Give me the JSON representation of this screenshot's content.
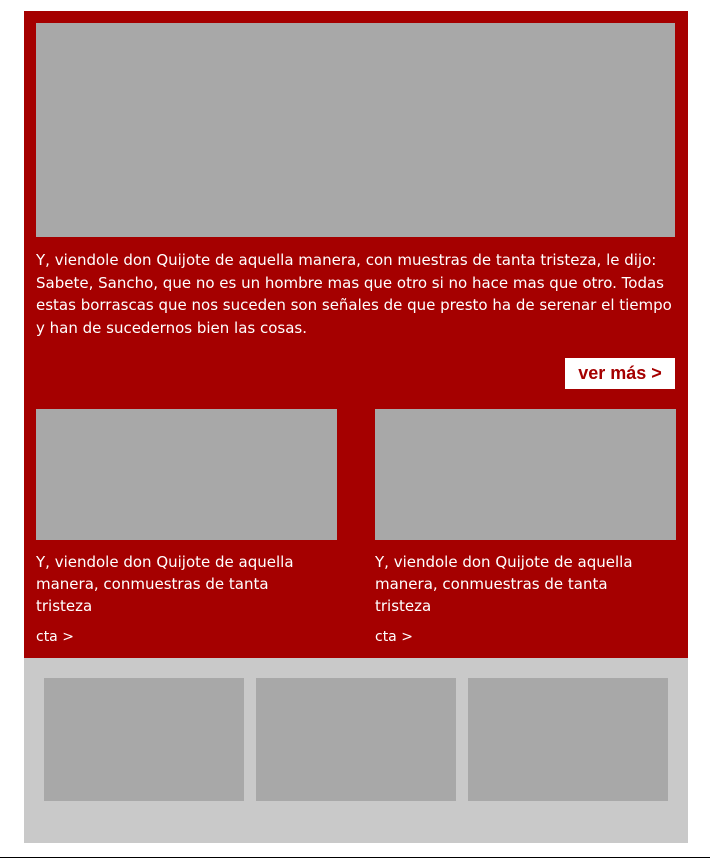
{
  "hero": {
    "text": "Y, viendole don Quijote de aquella manera, con muestras de tanta tristeza, le dijo: Sabete, Sancho, que no es un hombre mas que otro si no hace mas que otro. Todas estas borrascas que nos suceden son señales de que presto ha de serenar el tiempo y han de sucedernos bien las cosas.",
    "button_label": "ver más >"
  },
  "cards": [
    {
      "text": "Y, viendole don Quijote de aquella manera, conmuestras de tanta tristeza",
      "cta": "cta >"
    },
    {
      "text": "Y, viendole don Quijote de aquella manera, conmuestras de tanta tristeza",
      "cta": "cta >"
    }
  ],
  "colors": {
    "primary_red": "#a50000",
    "image_placeholder": "#a8a8a8",
    "footer_band": "#c9c9c9",
    "text_on_red": "#ffffff"
  }
}
